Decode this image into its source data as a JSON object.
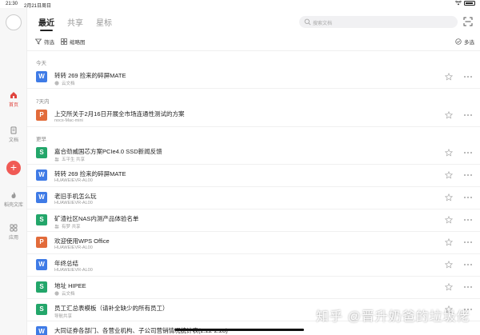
{
  "status": {
    "time": "21:30",
    "date": "2月21日周日"
  },
  "sidebar": {
    "items": [
      {
        "label": "首页",
        "icon": "home-icon"
      },
      {
        "label": "文档",
        "icon": "document-icon"
      },
      {
        "label": "稻壳文库",
        "icon": "flame-icon"
      },
      {
        "label": "应用",
        "icon": "apps-icon"
      }
    ],
    "add_icon": "+"
  },
  "header": {
    "tabs": [
      {
        "label": "最近"
      },
      {
        "label": "共享"
      },
      {
        "label": "星标"
      }
    ],
    "search_placeholder": "搜索文档"
  },
  "toolbar": {
    "filter": "筛选",
    "thumbnail": "缩略图",
    "multiselect": "多选"
  },
  "sections": {
    "today": "今天",
    "week": "7天内",
    "earlier": "更早"
  },
  "files": [
    {
      "type": "W",
      "title": "转转 269 捡来的碎屏MATE",
      "sub": "云文档"
    },
    {
      "type": "P",
      "title": "上交所关于2月16日开展全市场连通性测试的方案",
      "sub": "nocs-Mac-mini"
    },
    {
      "type": "S",
      "title": "嘉合劲威国芯方案PCIe4.0 SSD新闻反馈",
      "sub": "五平生 共享"
    },
    {
      "type": "W",
      "title": "转转 269 捡来的碎屏MATE",
      "sub": "HUAWEIEVR-AL00"
    },
    {
      "type": "W",
      "title": "老旧手机怎么玩",
      "sub": "HUAWEIEVR-AL00"
    },
    {
      "type": "S",
      "title": "矿渣社区NAS内测产品体验名单",
      "sub": "有梦 共享"
    },
    {
      "type": "P",
      "title": "欢迎使用WPS Office",
      "sub": "HUAWEIEVR-AL00"
    },
    {
      "type": "W",
      "title": "年终总结",
      "sub": "HUAWEIEVR-AL00"
    },
    {
      "type": "S",
      "title": "地址 HIPEE",
      "sub": "云文档"
    },
    {
      "type": "S",
      "title": "员工汇总表模板（请补全缺少的所有员工）",
      "sub": "导航共享"
    },
    {
      "type": "W",
      "title": "大同证券各部门、各营业机构、子公司营销情况统计表(2.22-2.28)",
      "sub": ""
    }
  ],
  "watermark": "知乎 @晋升奶爸的垃圾佬",
  "colors": {
    "word": "#3f7be6",
    "ppt": "#e26b3a",
    "sheet": "#23a66a",
    "accent": "#e0443e"
  }
}
